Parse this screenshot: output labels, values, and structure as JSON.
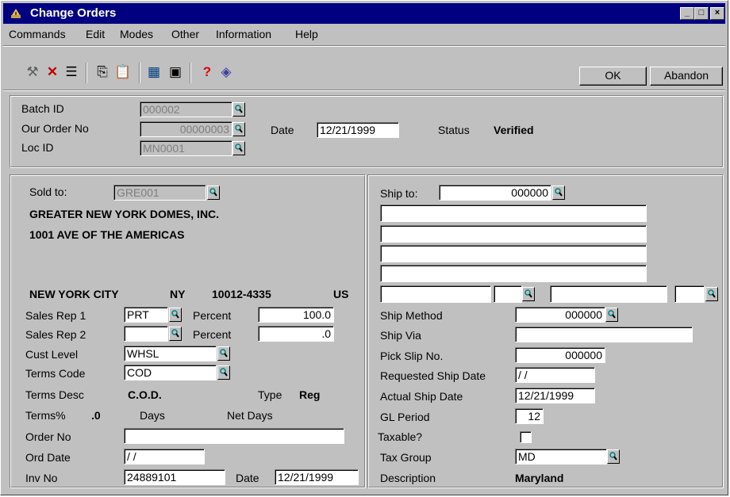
{
  "window": {
    "title": "Change Orders",
    "min_label": "_",
    "max_label": "□",
    "close_label": "×"
  },
  "menu": [
    "Commands",
    "Edit",
    "Modes",
    "Other",
    "Information",
    "Help"
  ],
  "toolbar": {
    "ok_label": "OK",
    "abandon_label": "Abandon",
    "icons": [
      "tools-icon",
      "delete-icon",
      "list-icon",
      "copy-icon",
      "paste-icon",
      "calculator-icon",
      "calendar-icon",
      "help-icon",
      "notes-icon"
    ]
  },
  "header": {
    "batch_id_label": "Batch ID",
    "batch_id": "000002",
    "order_no_label": "Our Order No",
    "order_no": "00000003",
    "loc_id_label": "Loc ID",
    "loc_id": "MN0001",
    "date_label": "Date",
    "date": "12/21/1999",
    "status_label": "Status",
    "status": "Verified"
  },
  "sold": {
    "sold_to_label": "Sold to:",
    "sold_to": "GRE001",
    "name": "GREATER NEW YORK DOMES, INC.",
    "address": "1001 AVE OF THE AMERICAS",
    "city": "NEW YORK CITY",
    "state": "NY",
    "zip": "10012-4335",
    "country": "US",
    "rep1_label": "Sales Rep 1",
    "rep1": "PRT",
    "percent_label": "Percent",
    "rep1_pct": "100.0",
    "rep2_label": "Sales Rep 2",
    "rep2": "",
    "rep2_pct": ".0",
    "cust_level_label": "Cust Level",
    "cust_level": "WHSL",
    "terms_code_label": "Terms Code",
    "terms_code": "COD",
    "terms_desc_label": "Terms Desc",
    "terms_desc": "C.O.D.",
    "type_label": "Type",
    "type": "Reg",
    "terms_pct_label": "Terms%",
    "terms_pct": ".0",
    "days_label": "Days",
    "net_days_label": "Net Days",
    "order_no_label": "Order No",
    "order_no": "",
    "ord_date_label": "Ord Date",
    "ord_date": " / /",
    "inv_no_label": "Inv No",
    "inv_no": "24889101",
    "inv_date_label": "Date",
    "inv_date": "12/21/1999"
  },
  "ship": {
    "ship_to_label": "Ship to:",
    "ship_to": "000000",
    "ship_method_label": "Ship Method",
    "ship_method": "000000",
    "ship_via_label": "Ship Via",
    "ship_via": "",
    "pick_slip_label": "Pick Slip No.",
    "pick_slip": "000000",
    "req_date_label": "Requested Ship Date",
    "req_date": " / /",
    "actual_date_label": "Actual Ship Date",
    "actual_date": "12/21/1999",
    "gl_period_label": "GL Period",
    "gl_period": "12",
    "taxable_label": "Taxable?",
    "tax_group_label": "Tax Group",
    "tax_group": "MD",
    "description_label": "Description",
    "description": "Maryland"
  }
}
